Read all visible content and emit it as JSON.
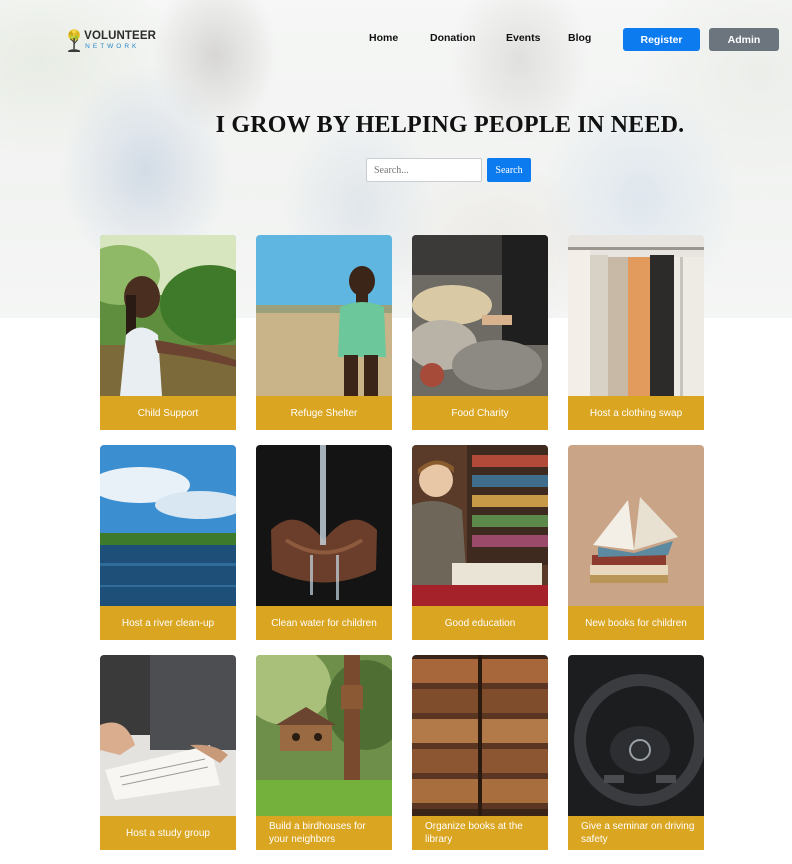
{
  "brand": {
    "name": "VOLUNTEER",
    "sub": "NETWORK",
    "logo_icon": "tree-icon",
    "accent": "#2a86c8"
  },
  "nav": {
    "items": [
      "Home",
      "Donation",
      "Events",
      "Blog"
    ],
    "register_label": "Register",
    "admin_label": "Admin",
    "register_color": "#0d7bf0",
    "admin_color": "#6c757d"
  },
  "hero": {
    "headline": "I GROW BY HELPING PEOPLE IN NEED."
  },
  "search": {
    "placeholder": "Search...",
    "button_label": "Search"
  },
  "cards": [
    {
      "label": "Child Support",
      "image": "girl-outdoors-photo"
    },
    {
      "label": "Refuge Shelter",
      "image": "boy-in-field-photo"
    },
    {
      "label": "Food Charity",
      "image": "food-market-photo"
    },
    {
      "label": "Host a clothing swap",
      "image": "clothing-rack-photo"
    },
    {
      "label": "Host a river clean-up",
      "image": "river-landscape-photo"
    },
    {
      "label": "Clean water for children",
      "image": "water-hands-photo"
    },
    {
      "label": "Good education",
      "image": "boy-reading-photo"
    },
    {
      "label": "New books for children",
      "image": "open-books-photo"
    },
    {
      "label": "Host a study group",
      "image": "study-papers-photo"
    },
    {
      "label": "Build a birdhouses for your neighbors",
      "image": "birdhouse-photo"
    },
    {
      "label": "Organize books at the library",
      "image": "library-shelves-photo"
    },
    {
      "label": "Give a seminar on driving safety",
      "image": "steering-wheel-photo"
    }
  ],
  "label_color": "#daa520"
}
